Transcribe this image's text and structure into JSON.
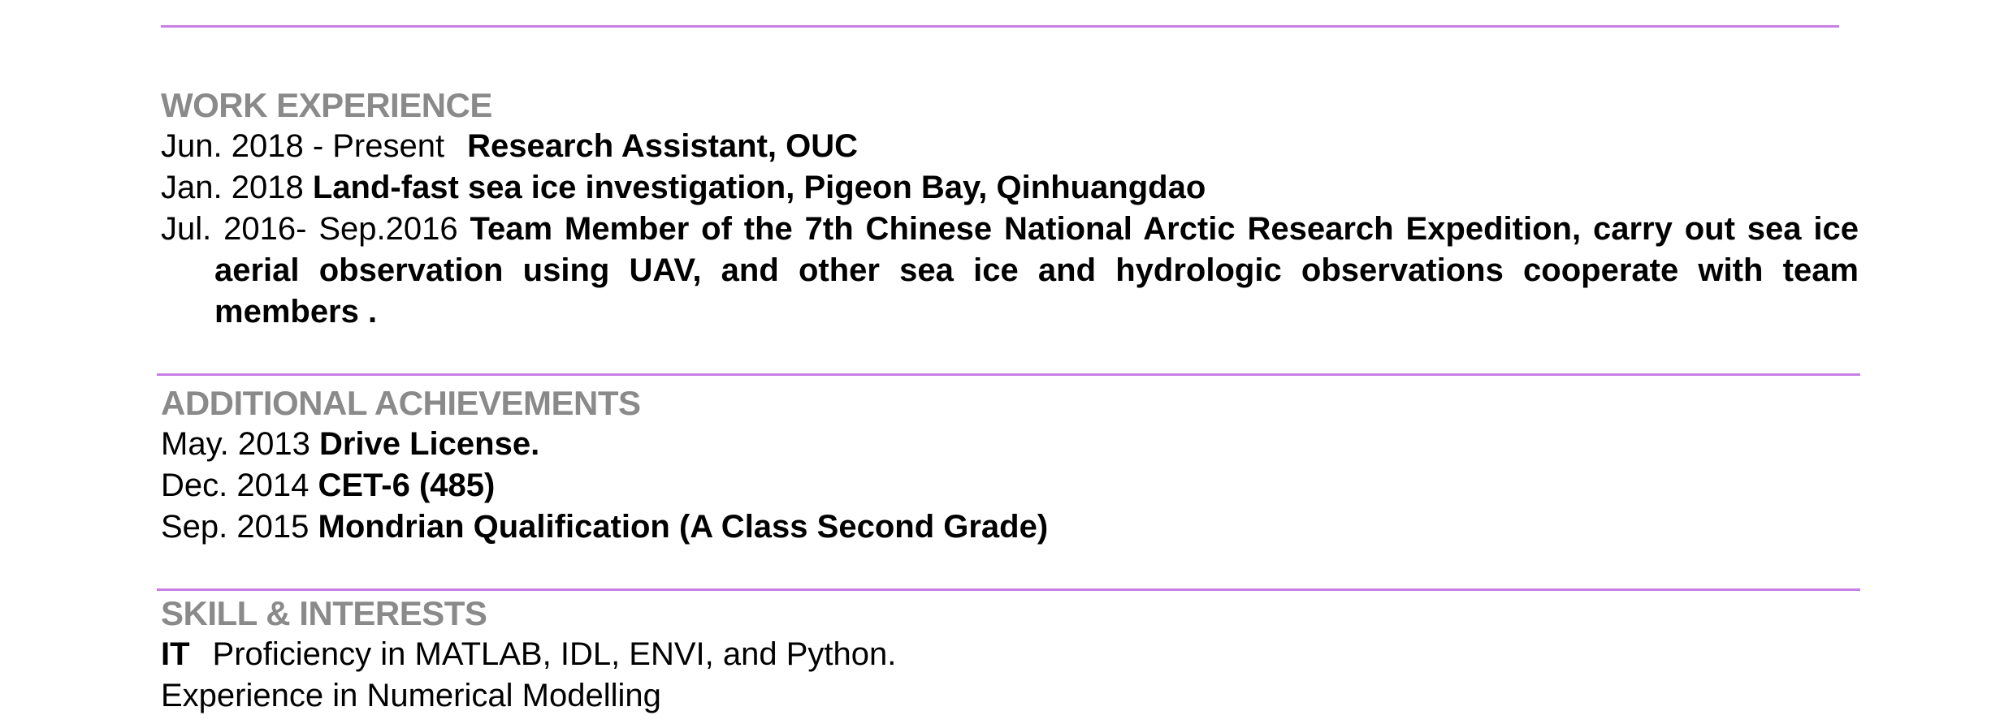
{
  "accent_color": "#c77ee6",
  "heading_color": "#8a8a8a",
  "work": {
    "heading": "WORK EXPERIENCE",
    "entries": [
      {
        "date": "Jun. 2018 - Present",
        "detail": "Research Assistant, OUC"
      },
      {
        "date": "Jan. 2018",
        "detail": "Land-fast sea ice investigation, Pigeon Bay, Qinhuangdao"
      },
      {
        "date": "Jul. 2016- Sep.2016",
        "detail": "Team Member of the 7th Chinese National Arctic Research Expedition, carry out sea ice aerial observation using UAV, and other sea ice and hydrologic observations cooperate with team members ."
      }
    ]
  },
  "achievements": {
    "heading": "ADDITIONAL ACHIEVEMENTS",
    "entries": [
      {
        "date": "May. 2013",
        "detail": "Drive License."
      },
      {
        "date": "Dec. 2014",
        "detail": "CET-6 (485)"
      },
      {
        "date": "Sep. 2015",
        "detail": "Mondrian Qualification (A Class Second Grade)"
      }
    ]
  },
  "skills": {
    "heading": "SKILL & INTERESTS",
    "it_label": "IT",
    "it_text": "Proficiency in MATLAB, IDL, ENVI, and Python.",
    "extra": "Experience in Numerical Modelling"
  }
}
